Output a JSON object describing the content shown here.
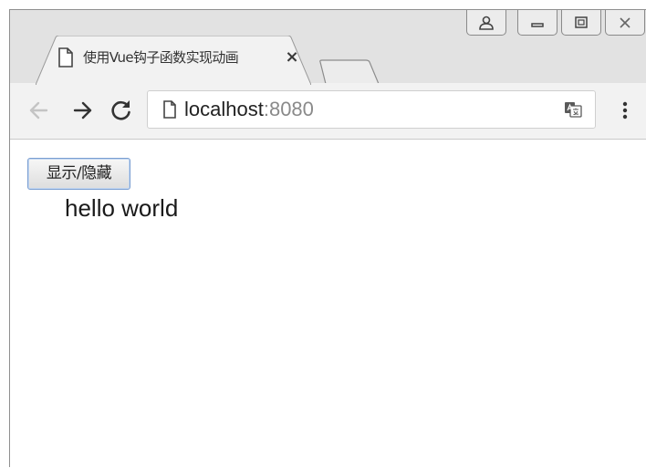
{
  "tab": {
    "title": "使用Vue钩子函数实现动画",
    "close_label": "×"
  },
  "window_controls": {
    "profile_icon": "person-icon",
    "minimize_icon": "minimize-icon",
    "restore_icon": "restore-icon",
    "close_icon": "close-icon"
  },
  "toolbar": {
    "back_icon": "arrow-left-icon",
    "forward_icon": "arrow-right-icon",
    "reload_icon": "reload-icon",
    "menu_icon": "more-vertical-icon"
  },
  "omnibox": {
    "host": "localhost",
    "port": ":8080",
    "page_icon": "page-icon",
    "translate_icon": "translate-icon"
  },
  "page": {
    "toggle_button_label": "显示/隐藏",
    "message": "hello world"
  },
  "colors": {
    "titlebar": "#e2e2e2",
    "toolbar": "#f2f2f2",
    "button_border": "#7a9ed1"
  }
}
